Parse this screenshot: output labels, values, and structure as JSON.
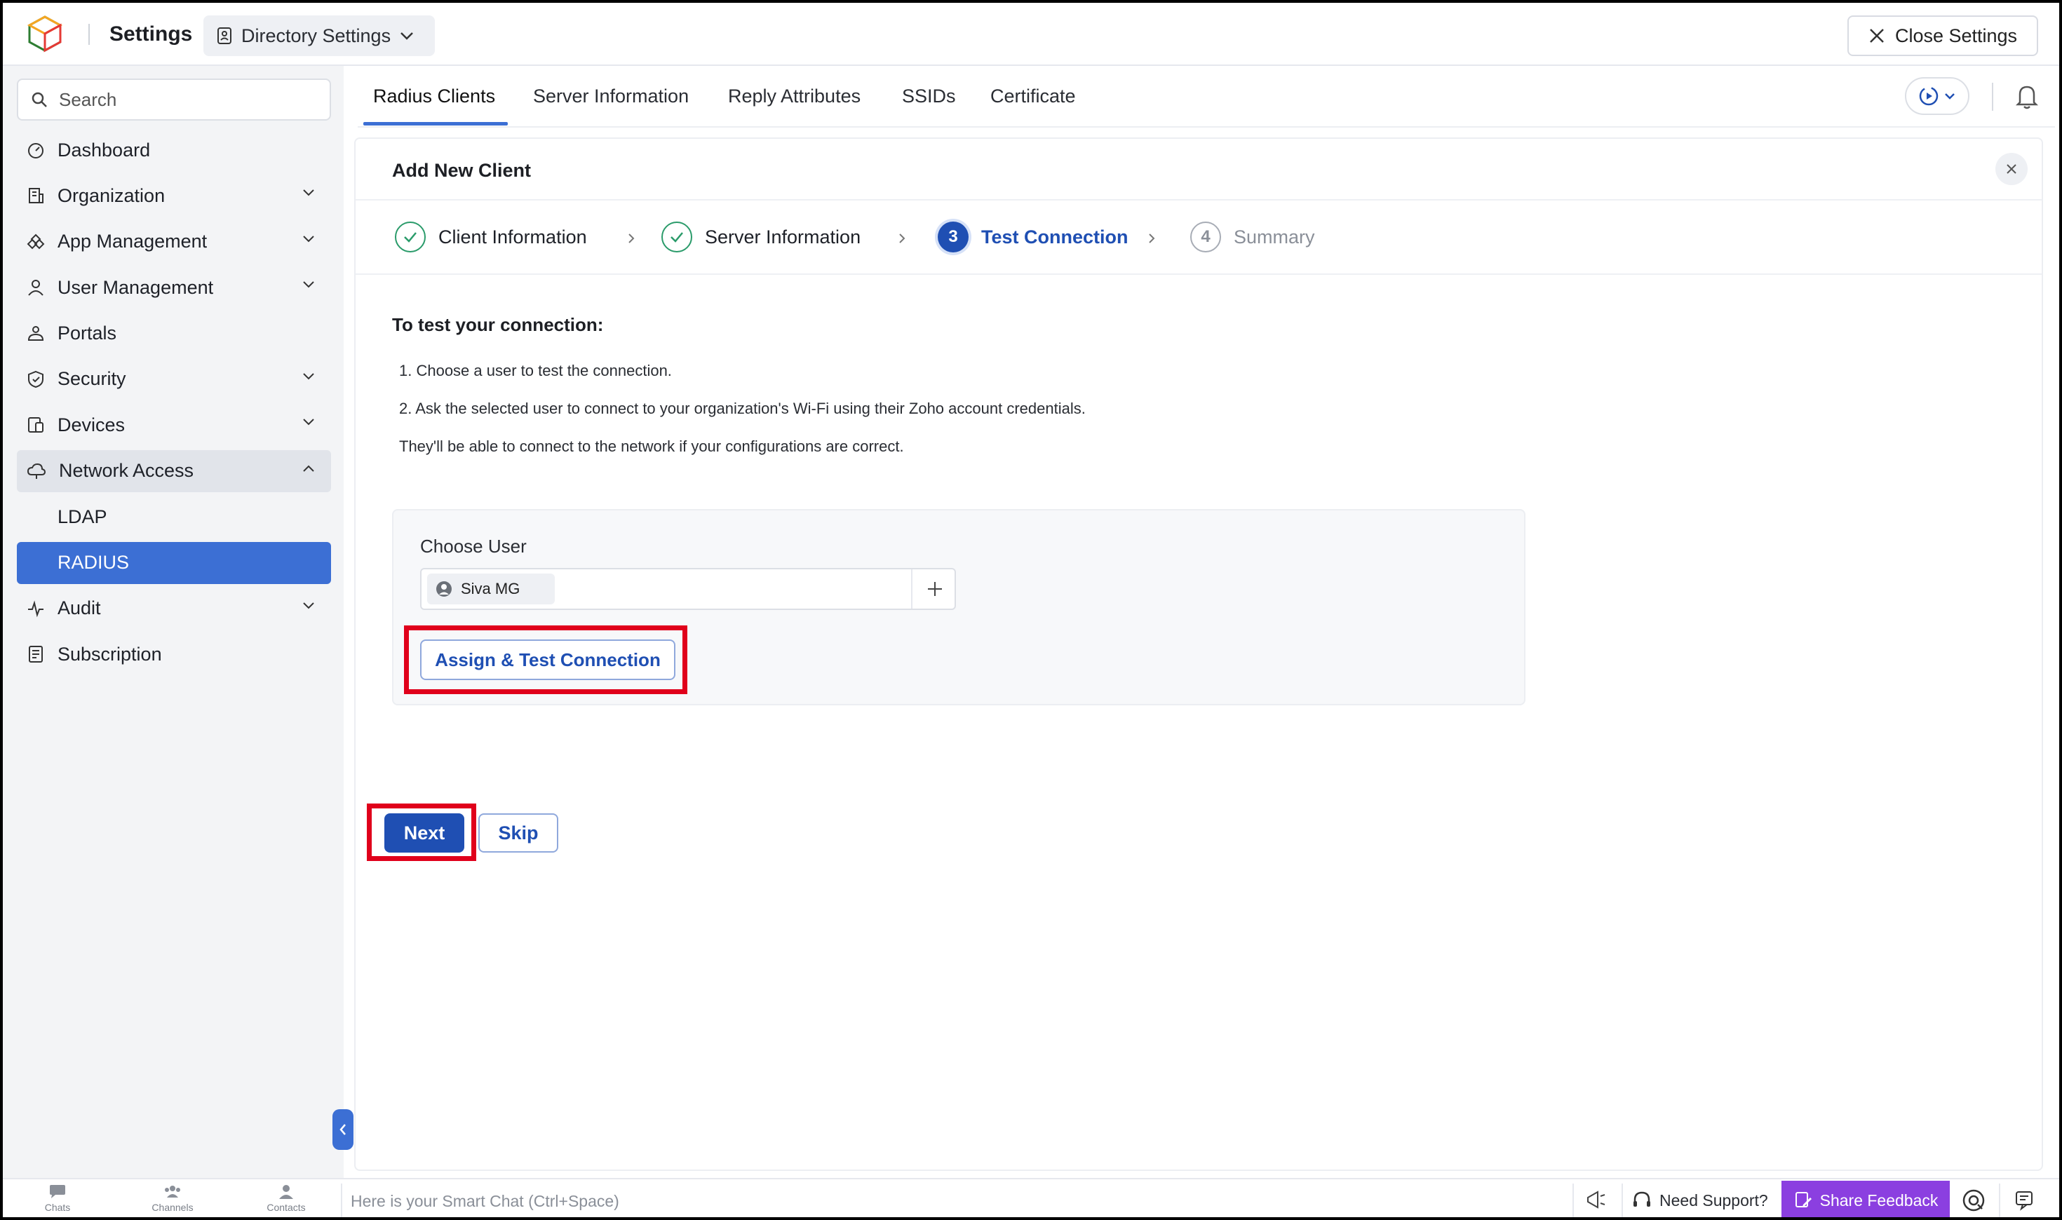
{
  "header": {
    "app_title": "Settings",
    "dir_settings_label": "Directory Settings",
    "close_label": "Close Settings"
  },
  "sidebar": {
    "search_placeholder": "Search",
    "items": [
      {
        "label": "Dashboard",
        "icon": "dashboard-icon"
      },
      {
        "label": "Organization",
        "icon": "building-icon",
        "expandable": true
      },
      {
        "label": "App Management",
        "icon": "apps-icon",
        "expandable": true
      },
      {
        "label": "User Management",
        "icon": "user-icon",
        "expandable": true
      },
      {
        "label": "Portals",
        "icon": "portal-icon"
      },
      {
        "label": "Security",
        "icon": "shield-icon",
        "expandable": true
      },
      {
        "label": "Devices",
        "icon": "devices-icon",
        "expandable": true
      },
      {
        "label": "Network Access",
        "icon": "cloud-icon",
        "expandable": true,
        "open": true
      },
      {
        "label": "LDAP",
        "sub": true
      },
      {
        "label": "RADIUS",
        "sub": true,
        "active": true
      },
      {
        "label": "Audit",
        "icon": "pulse-icon",
        "expandable": true
      },
      {
        "label": "Subscription",
        "icon": "receipt-icon"
      }
    ]
  },
  "tabs": [
    "Radius Clients",
    "Server Information",
    "Reply Attributes",
    "SSIDs",
    "Certificate"
  ],
  "card": {
    "title": "Add New Client",
    "steps": [
      {
        "label": "Client Information",
        "state": "done"
      },
      {
        "label": "Server Information",
        "state": "done"
      },
      {
        "label": "Test Connection",
        "state": "current",
        "number": "3"
      },
      {
        "label": "Summary",
        "state": "todo",
        "number": "4"
      }
    ],
    "heading": "To test your connection:",
    "instructions": [
      "1. Choose a user to test the connection.",
      "2. Ask the selected user to connect to your organization's Wi-Fi using their Zoho account credentials.",
      "They'll be able to connect to the network if your configurations are correct."
    ],
    "choose_user_label": "Choose User",
    "selected_user": "Siva MG",
    "assign_button": "Assign & Test Connection",
    "next_button": "Next",
    "skip_button": "Skip"
  },
  "bottombar": {
    "chats": "Chats",
    "channels": "Channels",
    "contacts": "Contacts",
    "smart_chat_placeholder": "Here is your Smart Chat (Ctrl+Space)",
    "need_support": "Need Support?",
    "share_feedback": "Share Feedback"
  },
  "colors": {
    "accent": "#3c6fd4",
    "primary_button": "#1f4fb3",
    "done_check": "#2a9b6a",
    "highlight": "#e0001b",
    "feedback": "#8b3fe0"
  }
}
